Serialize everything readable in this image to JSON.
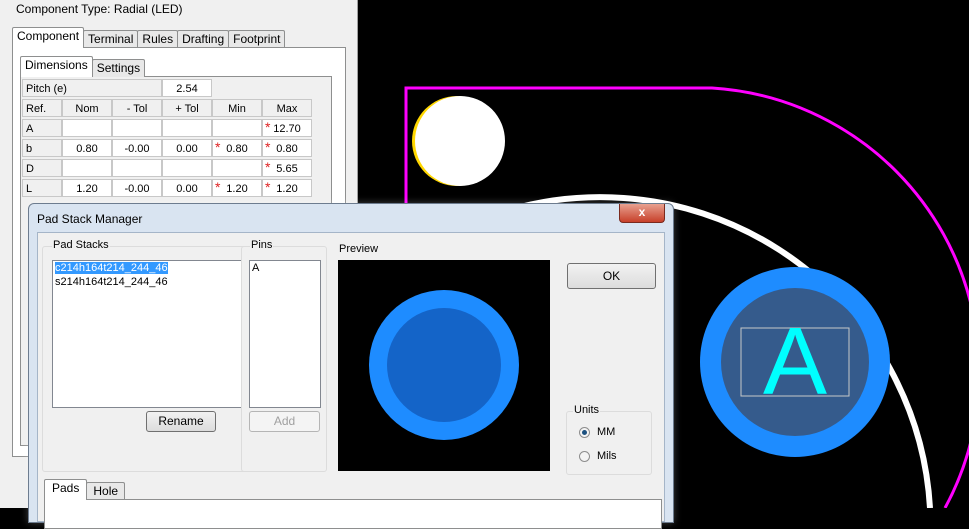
{
  "component_panel": {
    "component_type": "Component Type: Radial (LED)",
    "main_tabs": [
      "Component",
      "Terminal",
      "Rules",
      "Drafting",
      "Footprint"
    ],
    "sub_tabs": [
      "Dimensions",
      "Settings"
    ],
    "pitch": {
      "label": "Pitch (e)",
      "value": "2.54"
    },
    "columns": [
      "Ref.",
      "Nom",
      "- Tol",
      "+ Tol",
      "Min",
      "Max"
    ],
    "rows": [
      {
        "ref": "A",
        "nom": "",
        "tol_minus": "",
        "tol_plus": "",
        "min": "",
        "max": "12.70",
        "min_req": false,
        "max_req": true
      },
      {
        "ref": "b",
        "nom": "0.80",
        "tol_minus": "-0.00",
        "tol_plus": "0.00",
        "min": "0.80",
        "max": "0.80",
        "min_req": true,
        "max_req": true
      },
      {
        "ref": "D",
        "nom": "",
        "tol_minus": "",
        "tol_plus": "",
        "min": "",
        "max": "5.65",
        "min_req": false,
        "max_req": true
      },
      {
        "ref": "L",
        "nom": "1.20",
        "tol_minus": "-0.00",
        "tol_plus": "0.00",
        "min": "1.20",
        "max": "1.20",
        "min_req": true,
        "max_req": true
      }
    ],
    "required_mark": "*"
  },
  "dialog": {
    "title": "Pad Stack Manager",
    "close_glyph": "x",
    "pad_stacks_label": "Pad Stacks",
    "pad_stacks": [
      "c214h164t214_244_46",
      "s214h164t214_244_46"
    ],
    "pins_label": "Pins",
    "pins": [
      "A"
    ],
    "preview_label": "Preview",
    "rename_button": "Rename",
    "add_button": "Add",
    "ok_button": "OK",
    "units": {
      "label": "Units",
      "options": [
        "MM",
        "Mils"
      ],
      "selected": "MM"
    },
    "bottom_tabs": [
      "Pads",
      "Hole"
    ]
  },
  "canvas": {
    "pin_label": "A",
    "colors": {
      "courtyard": "#ff00ff",
      "pad_outer": "#1e90ff",
      "pad_inner": "#1464c8",
      "pad_text": "#00ffff",
      "silkscreen": "#ffffff",
      "pin1_marker": "#ffd700"
    }
  },
  "preview": {
    "colors": {
      "outer": "#1e8cff",
      "inner": "#1464c8",
      "background": "#000000"
    }
  }
}
